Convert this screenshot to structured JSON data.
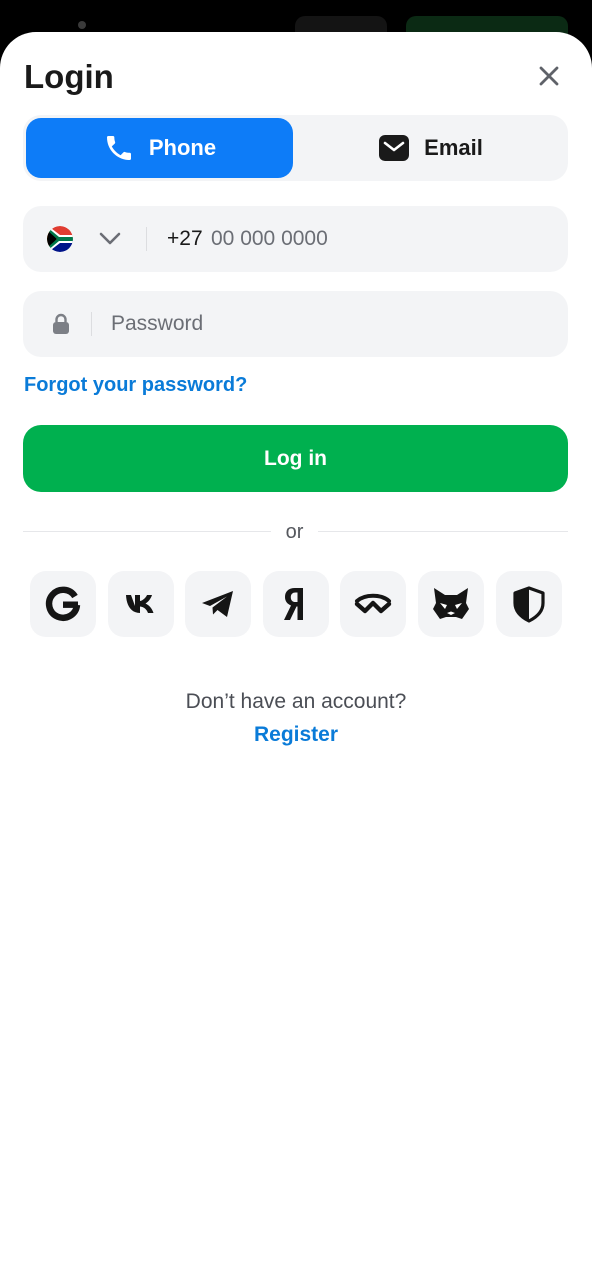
{
  "login": {
    "title": "Login",
    "tabs": [
      {
        "label": "Phone",
        "icon": "phone-icon",
        "active": true
      },
      {
        "label": "Email",
        "icon": "email-icon",
        "active": false
      }
    ],
    "phone": {
      "country_flag": "south-africa-flag-icon",
      "prefix": "+27",
      "placeholder": "00 000 0000"
    },
    "password": {
      "placeholder": "Password"
    },
    "forgot_label": "Forgot your password?",
    "login_button": "Log in",
    "divider_text": "or",
    "social_providers": [
      "google",
      "vk",
      "telegram",
      "yandex",
      "walletconnect",
      "metamask",
      "shield"
    ],
    "no_account": "Don’t have an account?",
    "register_label": "Register"
  },
  "colors": {
    "primary_blue": "#0d7cf8",
    "link_blue": "#0a7bd8",
    "login_green": "#00b04f",
    "field_bg": "#f3f4f6",
    "text_dark": "#1a1a1a"
  }
}
